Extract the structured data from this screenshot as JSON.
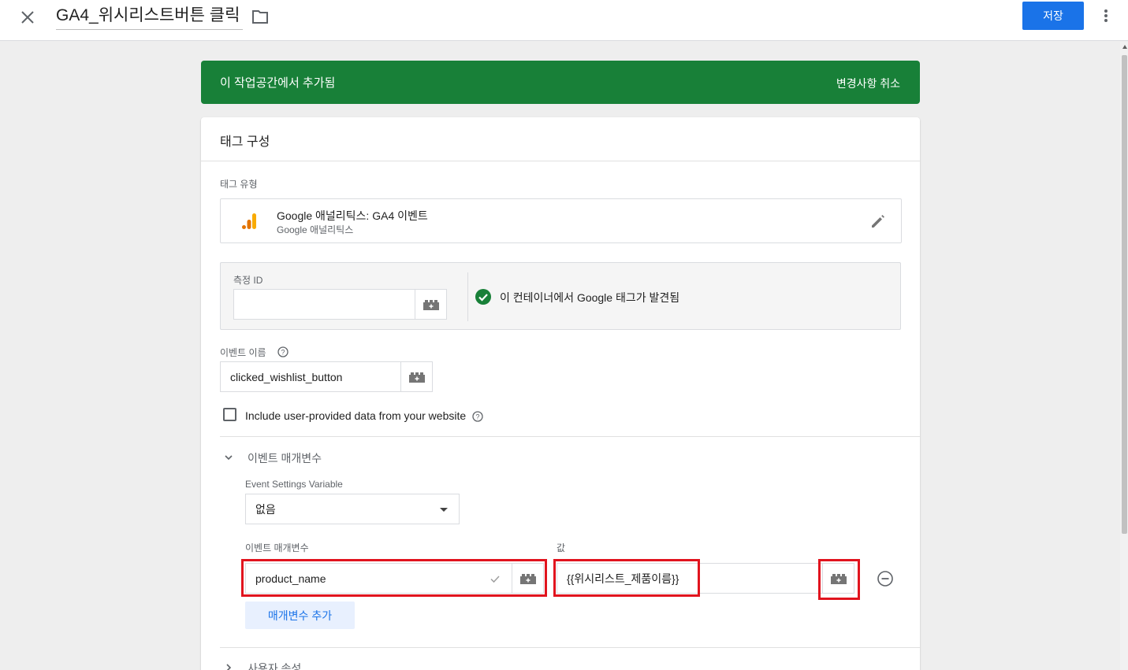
{
  "header": {
    "title": "GA4_위시리스트버튼 클릭",
    "save_label": "저장",
    "close_icon": "close-icon",
    "folder_icon": "folder-icon",
    "more_icon": "more-vert-icon"
  },
  "banner": {
    "text": "이 작업공간에서 추가됨",
    "action": "변경사항 취소",
    "color": "#188038"
  },
  "tag_config": {
    "title": "태그 구성",
    "tag_type_label": "태그 유형",
    "tag_type_name": "Google 애널리틱스: GA4 이벤트",
    "tag_type_sub": "Google 애널리틱스",
    "measurement_id_label": "측정 ID",
    "measurement_id_value": "",
    "google_tag_found": "이 컨테이너에서 Google 태그가 발견됨",
    "event_name_label": "이벤트 이름",
    "event_name_value": "clicked_wishlist_button",
    "include_user_data_label": "Include user-provided data from your website",
    "include_user_data_checked": false
  },
  "event_params": {
    "section_title": "이벤트 매개변수",
    "settings_variable_label": "Event Settings Variable",
    "settings_variable_value": "없음",
    "param_col_label": "이벤트 매개변수",
    "value_col_label": "값",
    "rows": [
      {
        "param": "product_name",
        "value": "{{위시리스트_제품이름}}"
      }
    ],
    "add_button_label": "매개변수 추가"
  },
  "user_props": {
    "section_title": "사용자 속성"
  },
  "colors": {
    "primary": "#1a73e8",
    "highlight": "#e1141e",
    "success": "#188038"
  }
}
